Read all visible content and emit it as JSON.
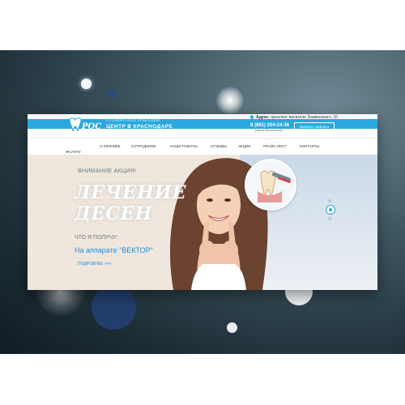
{
  "header": {
    "clinic_type": "СТОМАТОЛОГИЧЕСКИЙ",
    "clinic_title": "ЦЕНТР В КРАСНОДАРЕ",
    "address_label": "Адрес:",
    "address_value": "проспект писателя Знаменского, 10",
    "phone": "8 (861) 204-24-36",
    "phone_note": "(звонок бесплатный)",
    "callback_label": "Заказать звонок"
  },
  "nav": {
    "items": [
      "УСЛУГИ",
      "О КЛИНИКЕ",
      "СОТРУДНИКИ",
      "НАШИ РАБОТЫ",
      "ОТЗЫВЫ",
      "АКЦИИ",
      "ПРАЙС-ЛИСТ",
      "КОНТАКТЫ"
    ]
  },
  "hero": {
    "badge": "ВНИМАНИЕ АКЦИЯ!",
    "headline_line1": "ЛЕЧЕНИЕ",
    "headline_line2": "ДЕСЕН",
    "what_label": "ЧТО Я ПОЛУЧУ:",
    "device_text": "На аппарате \"ВЕКТОР\"",
    "more_link": "ПОДРОБНЕЕ >>>"
  },
  "colors": {
    "accent": "#29a8df",
    "hero_bg": "#efe6dd",
    "backdrop": "#2c4049"
  },
  "icons": {
    "logo": "tooth-logo-icon",
    "pin": "map-pin-icon",
    "callback_arrow": "chevron-right-icon",
    "dropdown": "chevron-down-icon"
  }
}
